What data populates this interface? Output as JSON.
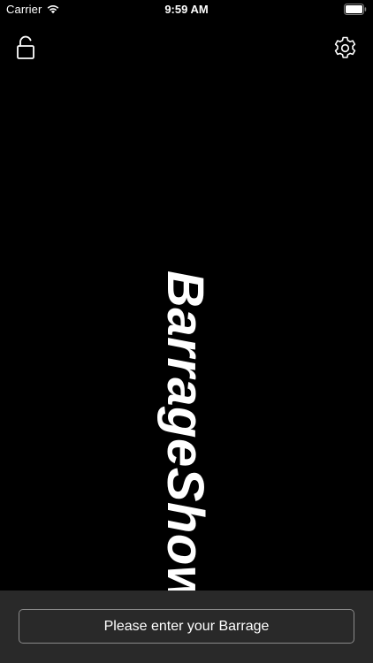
{
  "status_bar": {
    "carrier": "Carrier",
    "time": "9:59 AM",
    "wifi_icon": "wifi-icon",
    "battery_icon": "battery-icon"
  },
  "toolbar": {
    "lock_icon": "unlock-icon",
    "settings_icon": "gear-icon"
  },
  "barrage": {
    "text": "BarrageShowis"
  },
  "input": {
    "placeholder": "Please enter your Barrage",
    "value": ""
  },
  "colors": {
    "background": "#000000",
    "text": "#ffffff",
    "input_bar": "#2d2d2d",
    "input_border": "#8a8a8a"
  }
}
